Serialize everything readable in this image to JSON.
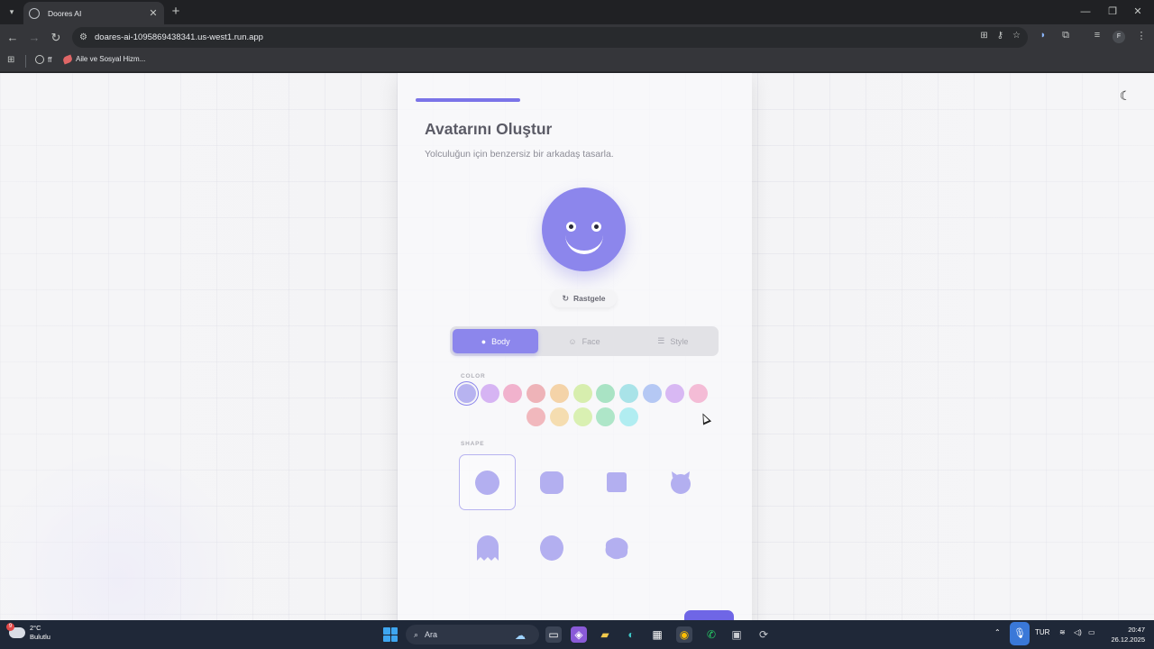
{
  "browser": {
    "tab_title": "Doores AI",
    "url": "doares-ai-1095869438341.us-west1.run.app",
    "bookmarks": [
      {
        "label": "ff"
      },
      {
        "label": "Aile ve Sosyal Hizm..."
      }
    ],
    "profile_initial": "F"
  },
  "page": {
    "title": "Avatarını Oluştur",
    "subtitle": "Yolculuğun için benzersiz bir arkadaş tasarla.",
    "progress_fraction": 0.33,
    "avatar_color": "#8c86ec",
    "random_button": "Rastgele",
    "tabs": [
      {
        "label": "Body",
        "icon": "user-icon",
        "active": true
      },
      {
        "label": "Face",
        "icon": "face-icon",
        "active": false
      },
      {
        "label": "Style",
        "icon": "sliders-icon",
        "active": false
      }
    ],
    "color_label": "COLOR",
    "colors": [
      "#b7b3f0",
      "#d6b4f3",
      "#f1b2cd",
      "#eeb3b8",
      "#f4d3a8",
      "#d7eeae",
      "#a9e3c4",
      "#a9e3e8",
      "#b5c8f4",
      "#d8b8f3",
      "#f4bcd6",
      "#f1b8bd",
      "#f5ddb0",
      "#d9f0b2",
      "#aee6c8",
      "#b1edf1"
    ],
    "selected_color_index": 0,
    "shape_label": "SHAPE",
    "shapes": [
      {
        "name": "circle",
        "selected": true
      },
      {
        "name": "rounded-square",
        "selected": false
      },
      {
        "name": "square",
        "selected": false
      },
      {
        "name": "horned",
        "selected": false
      },
      {
        "name": "ghost",
        "selected": false
      },
      {
        "name": "oval",
        "selected": false
      },
      {
        "name": "blob",
        "selected": false
      }
    ],
    "accent_color": "#7b74e8"
  },
  "taskbar": {
    "weather_temp": "2°C",
    "weather_desc": "Bulutlu",
    "weather_badge": "9",
    "search_placeholder": "Ara",
    "language": "TUR",
    "time": "20:47",
    "date": "26.12.2025"
  }
}
